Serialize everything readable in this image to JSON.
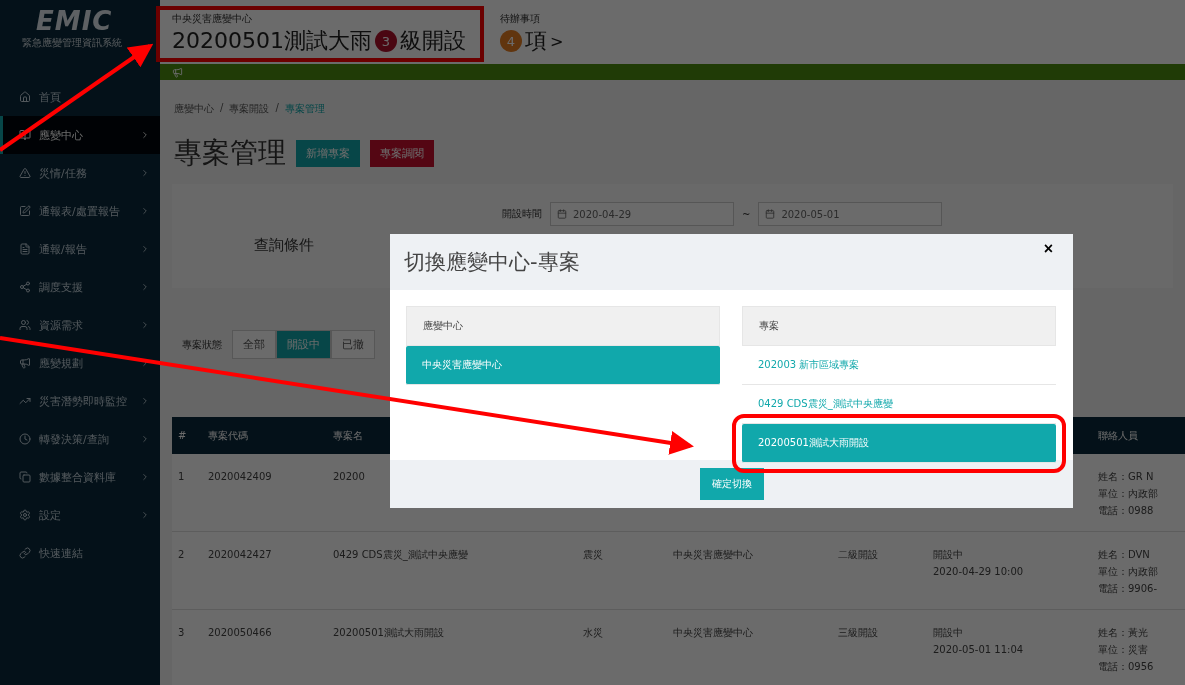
{
  "logo": {
    "title": "EMIC",
    "subtitle": "緊急應變管理資訊系統"
  },
  "header": {
    "center": "中央災害應變中心",
    "project": "20200501測試大雨",
    "level_badge": "3",
    "level_text": "級開設",
    "highlighted": true,
    "todo_label": "待辦事項",
    "todo_badge": "4",
    "todo_text": "項",
    "todo_more": ">"
  },
  "sidebar": {
    "items": [
      {
        "label": "首頁",
        "selected": false,
        "has_children": false
      },
      {
        "label": "應變中心",
        "selected": true,
        "has_children": true
      },
      {
        "label": "災情/任務",
        "selected": false,
        "has_children": true
      },
      {
        "label": "通報表/處置報告",
        "selected": false,
        "has_children": true
      },
      {
        "label": "通報/報告",
        "selected": false,
        "has_children": true
      },
      {
        "label": "調度支援",
        "selected": false,
        "has_children": true
      },
      {
        "label": "資源需求",
        "selected": false,
        "has_children": true
      },
      {
        "label": "應變規劃",
        "selected": false,
        "has_children": true
      },
      {
        "label": "災害潛勢即時監控",
        "selected": false,
        "has_children": true
      },
      {
        "label": "轉發決策/查詢",
        "selected": false,
        "has_children": true
      },
      {
        "label": "數據整合資料庫",
        "selected": false,
        "has_children": true
      },
      {
        "label": "設定",
        "selected": false,
        "has_children": true
      },
      {
        "label": "快速連結",
        "selected": false,
        "has_children": false
      }
    ]
  },
  "breadcrumb": {
    "separator": "/",
    "items": [
      "應變中心",
      "專案開設",
      "專案管理"
    ]
  },
  "page_title": "專案管理",
  "title_buttons": [
    {
      "label": "新增專案",
      "kind": "primary"
    },
    {
      "label": "專案調閱",
      "kind": "danger"
    }
  ],
  "query": {
    "title": "查詢條件",
    "date_label": "開設時間",
    "date_from": "2020-04-29",
    "date_sep": "~",
    "date_to": "2020-05-01"
  },
  "status_filter": {
    "label": "專案狀態",
    "options": [
      {
        "label": "全部",
        "selected": false
      },
      {
        "label": "開設中",
        "selected": true
      },
      {
        "label": "已撤",
        "selected": false
      }
    ]
  },
  "table": {
    "columns": [
      "#",
      "專案代碼",
      "專案名",
      "聯絡人員"
    ],
    "rows": [
      {
        "index": "1",
        "code": "2020042409",
        "name": "20200",
        "contact": [
          "姓名：GR N",
          "單位：內政部",
          "電話：0988"
        ]
      },
      {
        "index": "2",
        "code": "2020042427",
        "name": "0429 CDS震災_測試中央應變",
        "type": "震災",
        "center": "中央災害應變中心",
        "level": "二級開設",
        "status": "開設中",
        "time": "2020-04-29 10:00",
        "contact": [
          "姓名：DVN",
          "單位：內政部",
          "電話：9906-"
        ]
      },
      {
        "index": "3",
        "code": "2020050466",
        "name": "20200501測試大雨開設",
        "type": "水災",
        "center": "中央災害應變中心",
        "level": "三級開設",
        "status": "開設中",
        "time": "2020-05-01 11:04",
        "contact": [
          "姓名：黃光",
          "單位：災害",
          "電話：0956"
        ]
      }
    ]
  },
  "modal": {
    "title": "切換應變中心-專案",
    "close": "×",
    "centers": {
      "heading": "應變中心",
      "items": [
        {
          "label": "中央災害應變中心",
          "selected": true
        }
      ]
    },
    "projects": {
      "heading": "專案",
      "items": [
        {
          "label": "202003 新市區域專案",
          "selected": false,
          "highlighted": false
        },
        {
          "label": "0429 CDS震災_測試中央應變",
          "selected": false,
          "highlighted": false
        },
        {
          "label": "20200501測試大雨開設",
          "selected": true,
          "highlighted": true
        }
      ]
    },
    "confirm": "確定切換"
  }
}
